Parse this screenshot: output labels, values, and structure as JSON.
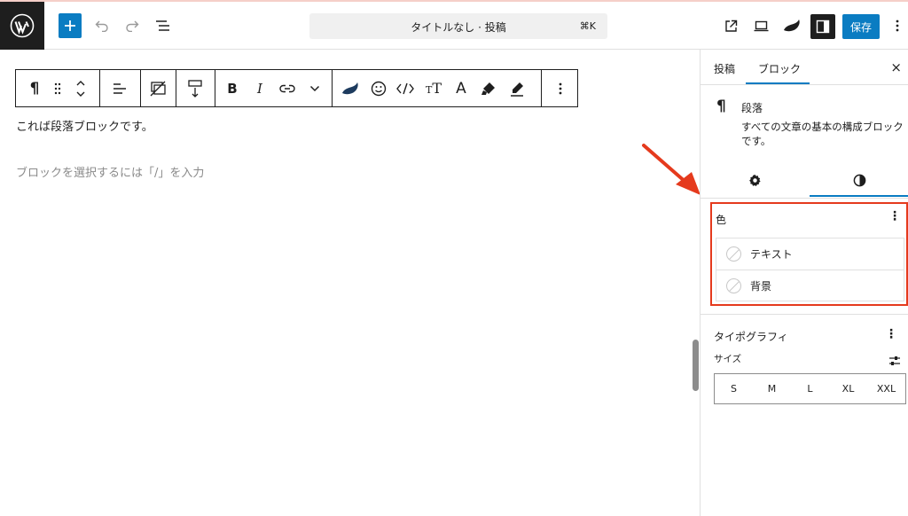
{
  "header": {
    "title": "タイトルなし · 投稿",
    "shortcut": "⌘K",
    "save_label": "保存",
    "add_icon": "plus-icon",
    "accent_color": "#0a7cc2"
  },
  "editor": {
    "paragraph_text": "これば段落ブロックです。",
    "placeholder_text": "ブロックを選択するには「/」を入力"
  },
  "sidebar": {
    "tabs": [
      {
        "label": "投稿"
      },
      {
        "label": "ブロック"
      }
    ],
    "close_label": "×",
    "block": {
      "icon": "¶",
      "title": "段落",
      "description": "すべての文章の基本の構成ブロックです。"
    },
    "color": {
      "title": "色",
      "menu": "⋮",
      "items": [
        {
          "label": "テキスト"
        },
        {
          "label": "背景"
        }
      ],
      "highlight_color": "#e53a1d"
    },
    "typography": {
      "title": "タイポグラフィ",
      "menu": "⋮",
      "size_label": "サイズ",
      "sizes": [
        "S",
        "M",
        "L",
        "XL",
        "XXL"
      ]
    }
  }
}
